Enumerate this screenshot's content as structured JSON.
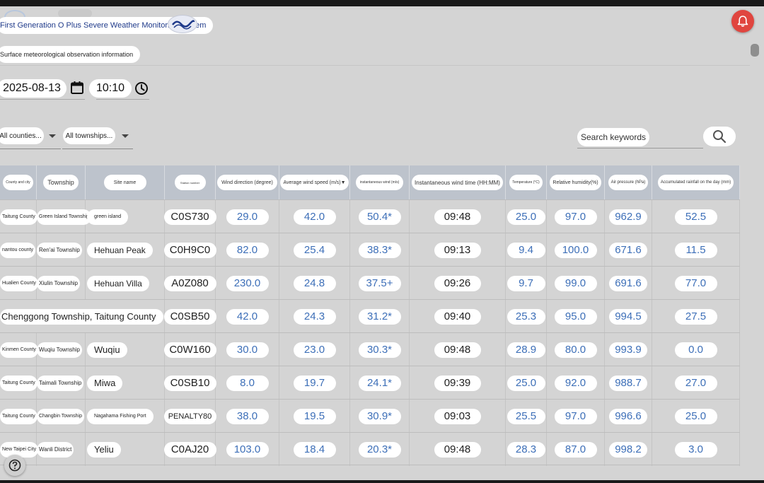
{
  "app": {
    "title": "First Generation O Plus Severe Weather Monitoring System",
    "subtitle": "Surface meteorological observation information"
  },
  "filters": {
    "date": "2025-08-13",
    "time": "10:10",
    "county_placeholder": "All counties...",
    "township_placeholder": "All townships...",
    "search_placeholder": "Search keywords"
  },
  "table": {
    "headers": [
      "County and city",
      "Township",
      "Site name",
      "Station number",
      "Wind direction (degree)",
      "Average wind speed (m/s)▼",
      "instantaneous wind (m/s)",
      "Instantaneous wind time (HH:MM)",
      "Temperature (°C)",
      "Relative humidity(%)",
      "Air pressure (hPa)",
      "Accumulated rainfall on the day (mm)"
    ],
    "rows": [
      {
        "county": "Taitung County",
        "township": "Green Island Township",
        "site": "green island",
        "station": "C0S730",
        "wdir": "29.0",
        "wavg": "42.0",
        "winst": "50.4*",
        "wtime": "09:48",
        "temp": "25.0",
        "rh": "97.0",
        "pres": "962.9",
        "rain": "52.5"
      },
      {
        "county": "nantou county",
        "township": "Ren'ai Township",
        "site": "Hehuan Peak",
        "station": "C0H9C0",
        "wdir": "82.0",
        "wavg": "25.4",
        "winst": "38.3*",
        "wtime": "09:13",
        "temp": "9.4",
        "rh": "100.0",
        "pres": "671.6",
        "rain": "11.5"
      },
      {
        "county": "Hualien County",
        "township": "Xiulin Township",
        "site": "Hehuan Villa",
        "station": "A0Z080",
        "wdir": "230.0",
        "wavg": "24.8",
        "winst": "37.5+",
        "wtime": "09:26",
        "temp": "9.7",
        "rh": "99.0",
        "pres": "691.6",
        "rain": "77.0"
      },
      {
        "county": "",
        "township": "",
        "site": "Chenggong Township, Taitung County",
        "station": "C0SB50",
        "wdir": "42.0",
        "wavg": "24.3",
        "winst": "31.2*",
        "wtime": "09:40",
        "temp": "25.3",
        "rh": "95.0",
        "pres": "994.5",
        "rain": "27.5"
      },
      {
        "county": "Kinmen County",
        "township": "Wuqiu Township",
        "site": "Wuqiu",
        "station": "C0W160",
        "wdir": "30.0",
        "wavg": "23.0",
        "winst": "30.3*",
        "wtime": "09:48",
        "temp": "28.9",
        "rh": "80.0",
        "pres": "993.9",
        "rain": "0.0"
      },
      {
        "county": "Taitung County",
        "township": "Taimali Township",
        "site": "Miwa",
        "station": "C0SB10",
        "wdir": "8.0",
        "wavg": "19.7",
        "winst": "24.1*",
        "wtime": "09:39",
        "temp": "25.0",
        "rh": "92.0",
        "pres": "988.7",
        "rain": "27.0"
      },
      {
        "county": "Taitung County",
        "township": "Changbin Township",
        "site": "Nagahama Fishing Port",
        "station": "PENALTY80",
        "wdir": "38.0",
        "wavg": "19.5",
        "winst": "30.9*",
        "wtime": "09:03",
        "temp": "25.5",
        "rh": "97.0",
        "pres": "996.6",
        "rain": "25.0"
      },
      {
        "county": "New Taipei City",
        "township": "Wanli District",
        "site": "Yeliu",
        "station": "C0AJ20",
        "wdir": "103.0",
        "wavg": "18.4",
        "winst": "20.3*",
        "wtime": "09:48",
        "temp": "28.3",
        "rh": "87.0",
        "pres": "998.2",
        "rain": "3.0"
      }
    ]
  },
  "colors": {
    "accent": "#3d6fb8",
    "bell": "#e0453f",
    "header_bg": "#bdc3cc",
    "page_bg": "#d4d4d4"
  },
  "icons": {
    "bell": "bell-icon",
    "calendar": "calendar-icon",
    "clock": "clock-icon",
    "search": "search-icon",
    "help": "help-icon"
  }
}
